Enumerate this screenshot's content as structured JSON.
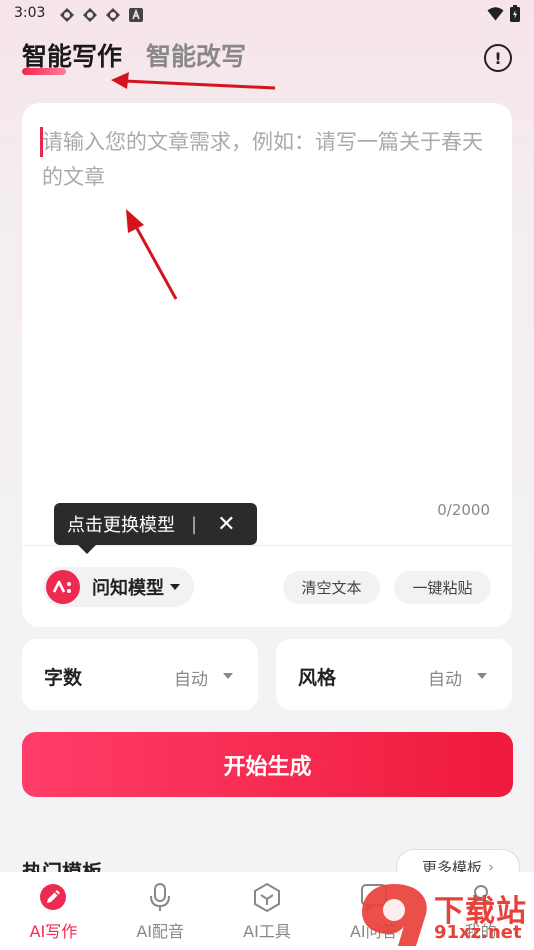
{
  "status_bar": {
    "time": "3:03"
  },
  "tabs": [
    {
      "label": "智能写作",
      "active": true
    },
    {
      "label": "智能改写",
      "active": false
    }
  ],
  "editor": {
    "placeholder": "请输入您的文章需求，例如：请写一篇关于春天的文章",
    "counter": "0/2000"
  },
  "tooltip": {
    "text": "点击更换模型",
    "separator": "|"
  },
  "model": {
    "label": "问知模型"
  },
  "chips": {
    "clear": "清空文本",
    "paste": "一键粘贴"
  },
  "options": {
    "word_count": {
      "label": "字数",
      "value": "自动"
    },
    "style": {
      "label": "风格",
      "value": "自动"
    }
  },
  "start_button": "开始生成",
  "hot_templates": {
    "title": "热门模板",
    "more": "更多模板"
  },
  "nav": [
    {
      "label": "AI写作",
      "icon": "pen-icon",
      "active": true
    },
    {
      "label": "AI配音",
      "icon": "microphone-icon",
      "active": false
    },
    {
      "label": "AI工具",
      "icon": "cube-icon",
      "active": false
    },
    {
      "label": "AI问答",
      "icon": "chat-icon",
      "active": false
    },
    {
      "label": "我的",
      "icon": "user-icon",
      "active": false
    }
  ],
  "watermark": {
    "line1": "下载站",
    "line2": "91xz.net"
  },
  "colors": {
    "accent": "#ee2a51",
    "arrow": "#d4141c"
  }
}
